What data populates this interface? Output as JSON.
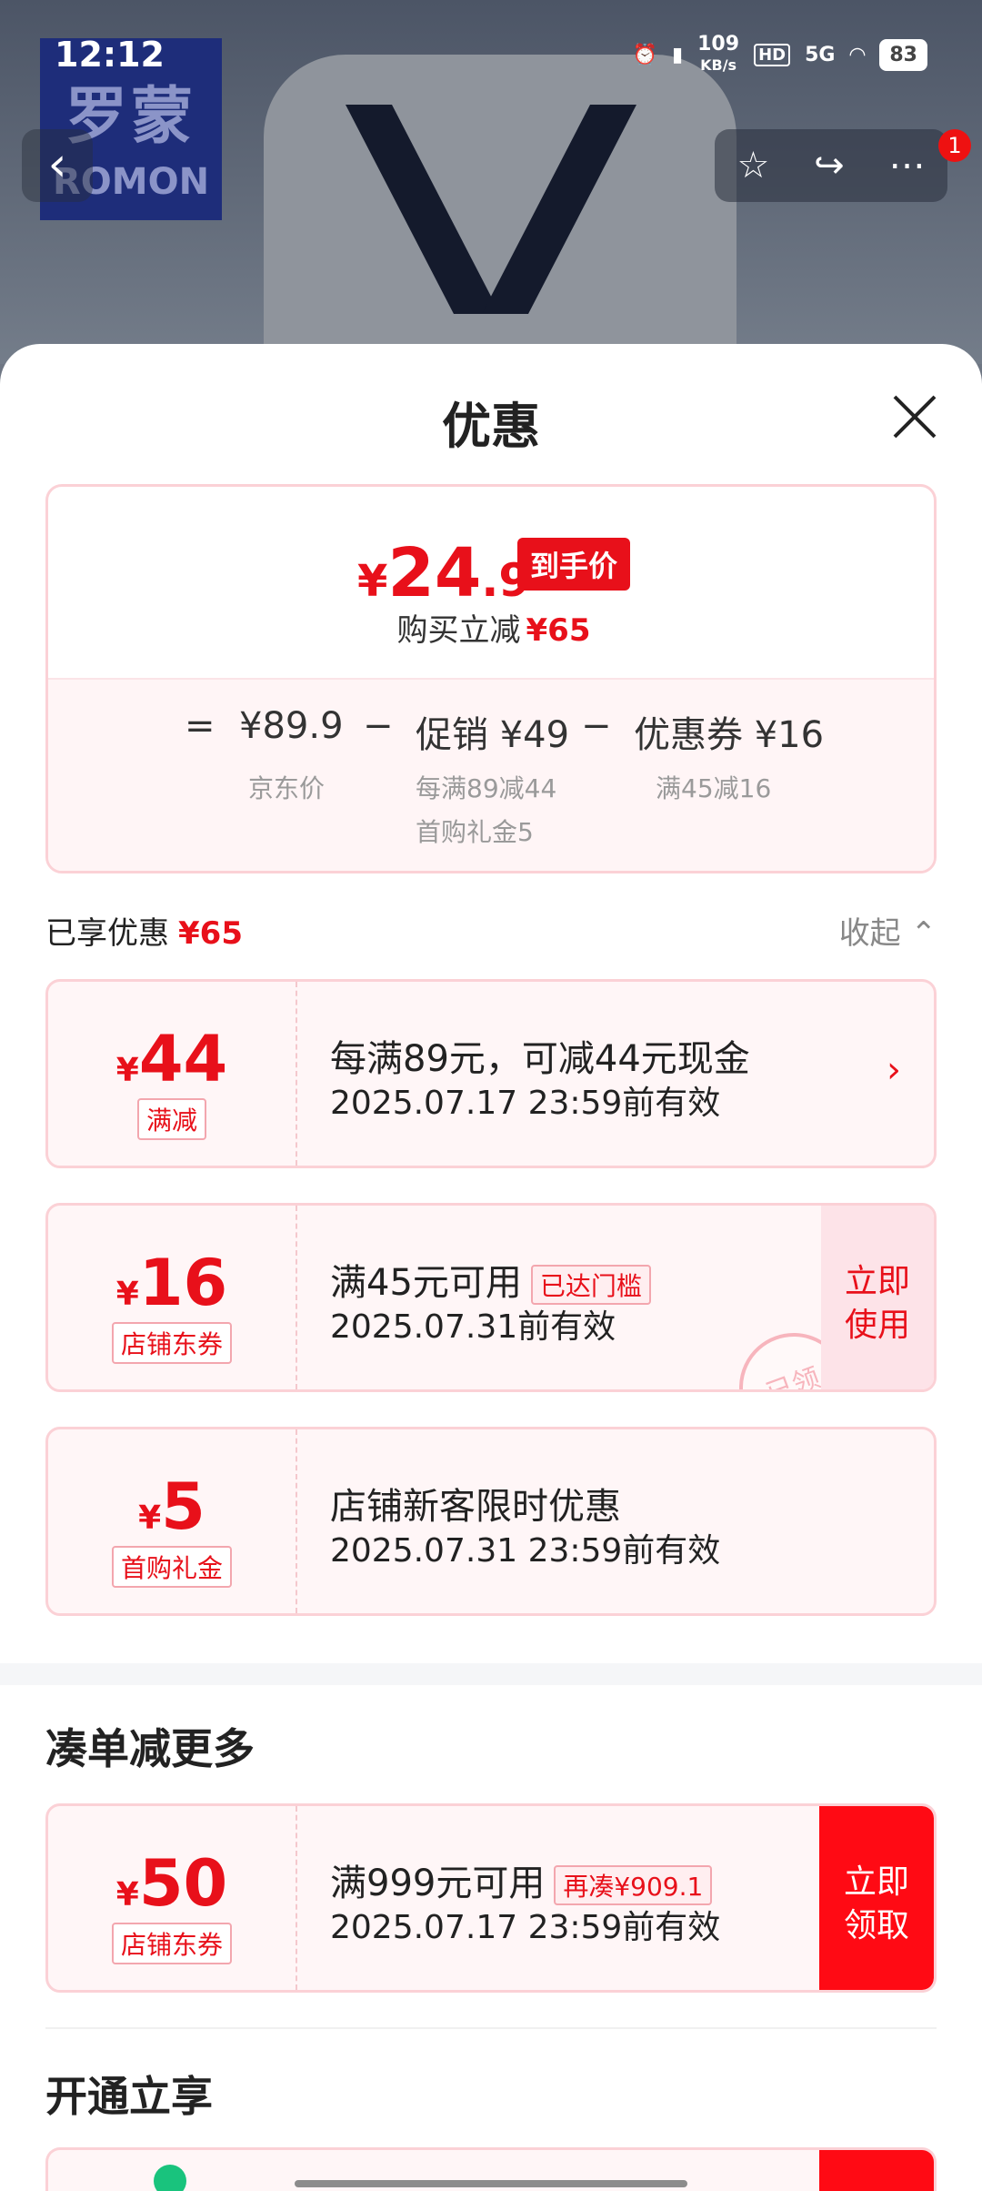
{
  "status_bar": {
    "time": "12:12",
    "net_speed": "109",
    "net_unit": "KB/s",
    "hd": "HD",
    "signal": "5G",
    "battery": "83"
  },
  "hero": {
    "logo_cn": "罗蒙",
    "logo_en": "ROMON",
    "notification_count": "1"
  },
  "sheet": {
    "title": "优惠"
  },
  "price": {
    "currency": "¥",
    "final_int": "24",
    "final_dec": ".9",
    "final_tag": "到手价",
    "save_label": "购买立减",
    "save_value": "¥65",
    "equals": "=",
    "minus": "−",
    "jd_price": "¥89.9",
    "jd_price_label": "京东价",
    "promo": "促销 ¥49",
    "promo_sub1": "每满89减44",
    "promo_sub2": "首购礼金5",
    "coupon": "优惠券 ¥16",
    "coupon_sub": "满45减16"
  },
  "enjoyed": {
    "label": "已享优惠",
    "value": "¥65",
    "collapse": "收起"
  },
  "coupons": [
    {
      "currency": "¥",
      "amount": "44",
      "kind": "满减",
      "line1": "每满89元，可减44元现金",
      "line2": "2025.07.17 23:59前有效",
      "arrow": "›"
    },
    {
      "currency": "¥",
      "amount": "16",
      "kind": "店铺东券",
      "line1": "满45元可用",
      "tag": "已达门槛",
      "line2": "2025.07.31前有效",
      "action": "立即使用",
      "stamp": "已领"
    },
    {
      "currency": "¥",
      "amount": "5",
      "kind": "首购礼金",
      "line1": "店铺新客限时优惠",
      "line2": "2025.07.31 23:59前有效"
    }
  ],
  "more_section": {
    "title": "凑单减更多"
  },
  "more_coupon": {
    "currency": "¥",
    "amount": "50",
    "kind": "店铺东券",
    "line1": "满999元可用",
    "tag": "再凑¥909.1",
    "line2": "2025.07.17 23:59前有效",
    "action": "立即领取"
  },
  "open_section": {
    "title": "开通立享"
  }
}
